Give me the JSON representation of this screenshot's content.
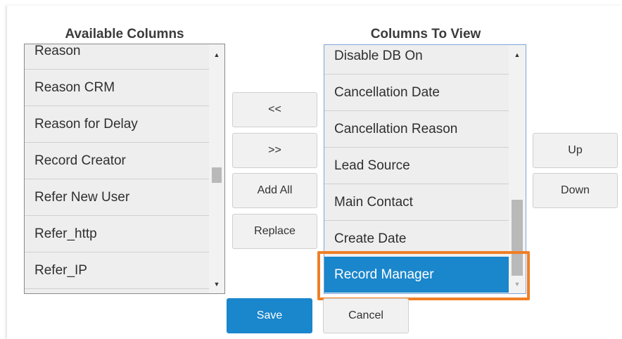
{
  "available": {
    "title": "Available Columns",
    "items": [
      "Reason",
      "Reason CRM",
      "Reason for Delay",
      "Record Creator",
      "Refer New User",
      "Refer_http",
      "Refer_IP"
    ]
  },
  "view": {
    "title": "Columns To View",
    "items": [
      "Disable DB On",
      "Cancellation Date",
      "Cancellation Reason",
      "Lead Source",
      "Main Contact",
      "Create Date",
      "Record Manager"
    ],
    "selected": "Record Manager"
  },
  "buttons": {
    "remove": "<<",
    "add": ">>",
    "add_all": "Add All",
    "replace": "Replace",
    "up": "Up",
    "down": "Down",
    "save": "Save",
    "cancel": "Cancel"
  },
  "icons": {
    "scroll_up": "triangle-up",
    "scroll_down": "triangle-down"
  },
  "colors": {
    "primary": "#1a86cc",
    "highlight": "#f07f26"
  }
}
